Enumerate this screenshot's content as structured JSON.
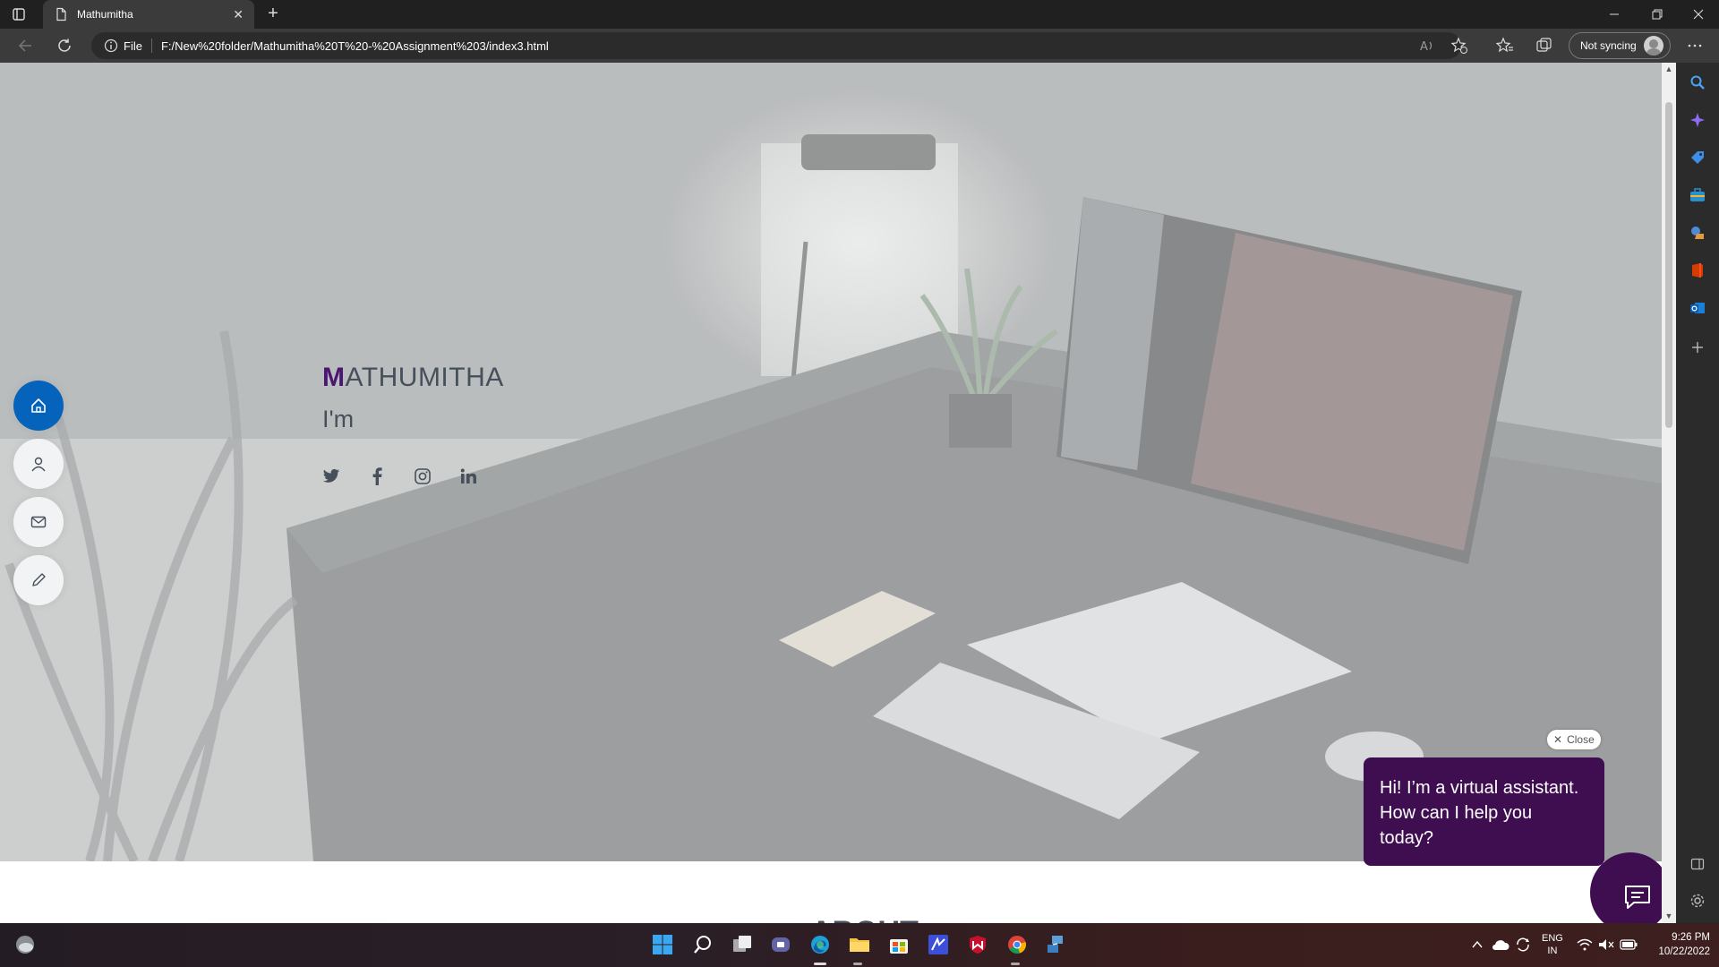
{
  "browser": {
    "tab_title": "Mathumitha",
    "url_scheme_label": "File",
    "url": "F:/New%20folder/Mathumitha%20T%20-%20Assignment%203/index3.html",
    "sync_label": "Not syncing"
  },
  "hero": {
    "name_initial": "M",
    "name_rest": "ATHUMITHA",
    "tagline": "I'm",
    "nav_items": [
      "home",
      "about",
      "contact",
      "resume"
    ],
    "social": [
      "twitter",
      "facebook",
      "instagram",
      "linkedin"
    ]
  },
  "section": {
    "about_title": "ABOUT"
  },
  "chat": {
    "close_label": "Close",
    "message": "Hi! I’m a virtual assistant. How can I help you today?"
  },
  "taskbar": {
    "lang_line1": "ENG",
    "lang_line2": "IN",
    "time": "9:26 PM",
    "date": "10/22/2022"
  },
  "colors": {
    "accent_purple": "#4b1670",
    "nav_active": "#0563bb",
    "chat_bg": "#3f0e51"
  }
}
